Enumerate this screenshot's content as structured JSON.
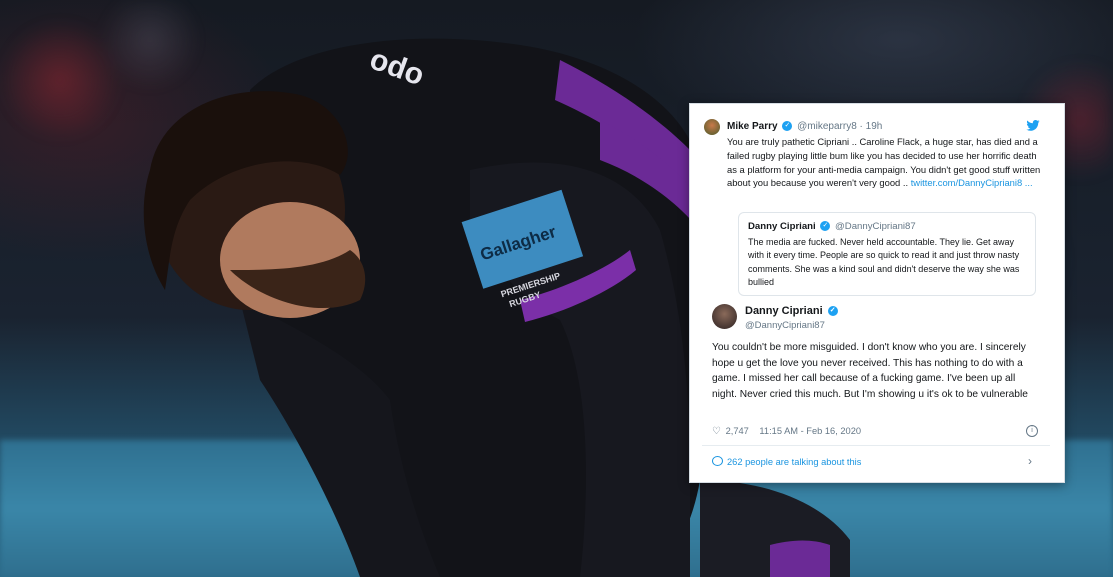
{
  "tweet_card": {
    "top_tweet": {
      "name": "Mike Parry",
      "handle_time": "@mikeparry8 · 19h",
      "text": "You are truly pathetic Cipriani .. Caroline Flack, a huge star, has died and a failed rugby playing little bum like you has decided to use her horrific death as a platform for your anti-media campaign. You didn't get good stuff written about you because you weren't very good .. ",
      "link": "twitter.com/DannyCipriani8 ..."
    },
    "quoted_tweet": {
      "name": "Danny Cipriani",
      "handle": "@DannyCipriani87",
      "text": "The media are fucked. Never held accountable. They lie. Get away with it every time. People are so quick to read it and just throw nasty comments. She was a kind soul and didn't deserve the way she was bullied"
    },
    "main_tweet": {
      "name": "Danny Cipriani",
      "handle": "@DannyCipriani87",
      "text": "You couldn't be more misguided. I don't know who you are. I sincerely hope u get the love you never received. This has nothing to do with a game. I missed her call because of a fucking game. I've been up all night. Never cried this much. But I'm showing u it's ok to be vulnerable",
      "likes": "2,747",
      "timestamp": "11:15 AM - Feb 16, 2020",
      "talking": "262 people are talking about this"
    }
  },
  "icons": {
    "verified": "verified-badge-icon",
    "twitter": "twitter-bird-icon",
    "heart": "heart-icon",
    "info": "info-icon",
    "comment": "comment-bubble-icon",
    "chevron": "chevron-right-icon"
  },
  "colors": {
    "twitter_blue": "#1da1f2",
    "link_blue": "#1b95e0",
    "jersey_purple": "#7b2fa8",
    "text_gray": "#657786"
  }
}
